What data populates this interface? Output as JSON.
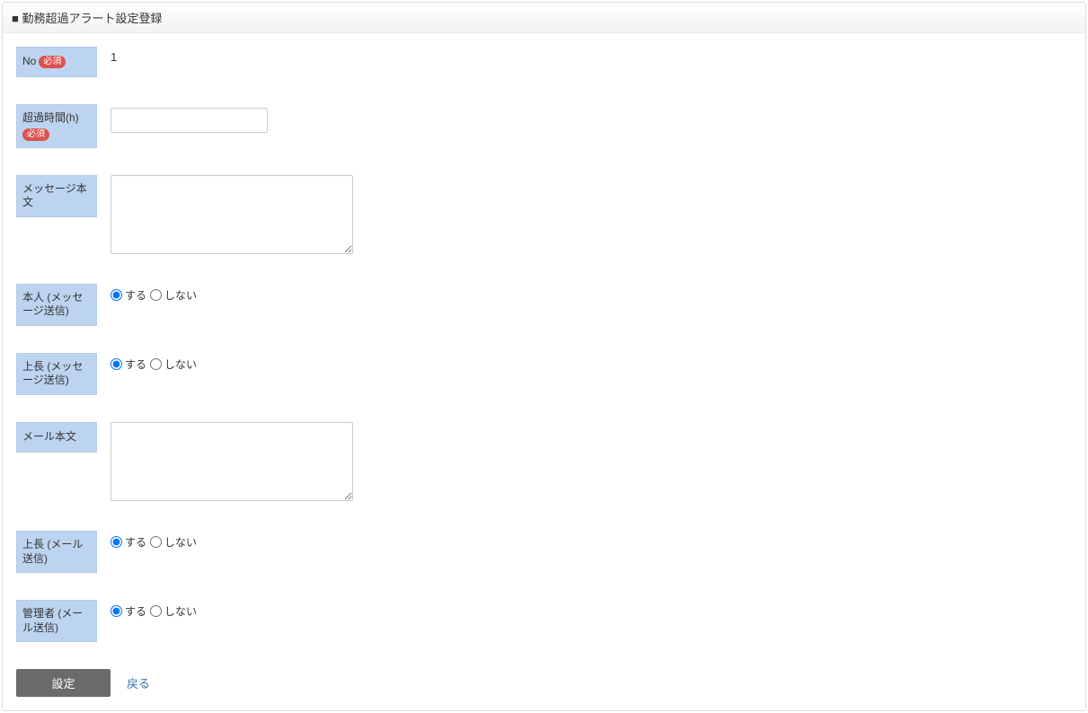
{
  "header": {
    "title": "■ 勤務超過アラート設定登録"
  },
  "form": {
    "fields": {
      "no": {
        "label": "No",
        "required_text": "必須",
        "value": "1"
      },
      "overtime_hours": {
        "label": "超過時間(h)",
        "required_text": "必須",
        "value": ""
      },
      "message_body": {
        "label": "メッセージ本文",
        "value": ""
      },
      "self_message": {
        "label": "本人 (メッセージ送信)",
        "option_yes": "する",
        "option_no": "しない"
      },
      "superior_message": {
        "label": "上長 (メッセージ送信)",
        "option_yes": "する",
        "option_no": "しない"
      },
      "mail_body": {
        "label": "メール本文",
        "value": ""
      },
      "superior_mail": {
        "label": "上長 (メール送信)",
        "option_yes": "する",
        "option_no": "しない"
      },
      "admin_mail": {
        "label": "管理者 (メール送信)",
        "option_yes": "する",
        "option_no": "しない"
      }
    },
    "buttons": {
      "submit": "設定",
      "back": "戻る"
    }
  }
}
